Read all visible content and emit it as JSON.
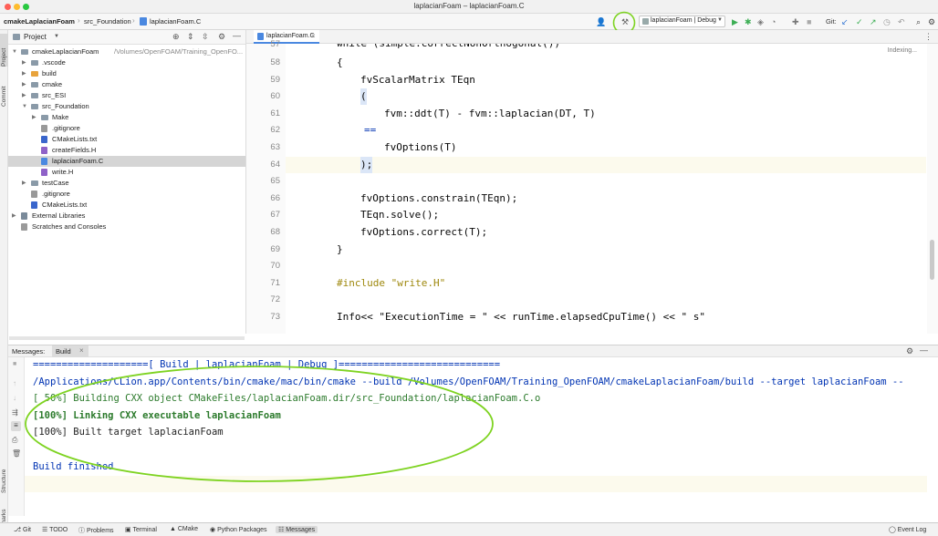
{
  "window": {
    "title": "laplacianFoam – laplacianFoam.C"
  },
  "navbar": {
    "crumbs": [
      "cmakeLaplacianFoam",
      "src_Foundation",
      "laplacianFoam.C"
    ],
    "run_config": "laplacianFoam | Debug",
    "git_label": "Git:"
  },
  "left_strip": {
    "items": [
      "Project",
      "Commit",
      "Structure",
      "Bookmarks"
    ]
  },
  "project_panel": {
    "title": "Project",
    "tree": [
      {
        "label": "cmakeLaplacianFoam",
        "path": "/Volumes/OpenFOAM/Training_OpenFO...",
        "kind": "folder",
        "indent": 0,
        "expanded": true
      },
      {
        "label": ".vscode",
        "kind": "folder",
        "indent": 1,
        "expanded": false
      },
      {
        "label": "build",
        "kind": "folder-orange",
        "indent": 1,
        "expanded": false
      },
      {
        "label": "cmake",
        "kind": "folder",
        "indent": 1,
        "expanded": false
      },
      {
        "label": "src_ESI",
        "kind": "folder",
        "indent": 1,
        "expanded": false
      },
      {
        "label": "src_Foundation",
        "kind": "folder",
        "indent": 1,
        "expanded": true
      },
      {
        "label": "Make",
        "kind": "folder",
        "indent": 2,
        "expanded": false
      },
      {
        "label": ".gitignore",
        "kind": "file-git",
        "indent": 2
      },
      {
        "label": "CMakeLists.txt",
        "kind": "file-cmake",
        "indent": 2
      },
      {
        "label": "createFields.H",
        "kind": "file-h",
        "indent": 2
      },
      {
        "label": "laplacianFoam.C",
        "kind": "file-c",
        "indent": 2,
        "selected": true
      },
      {
        "label": "write.H",
        "kind": "file-h",
        "indent": 2
      },
      {
        "label": "testCase",
        "kind": "folder",
        "indent": 1,
        "expanded": false
      },
      {
        "label": ".gitignore",
        "kind": "file-git",
        "indent": 1
      },
      {
        "label": "CMakeLists.txt",
        "kind": "file-cmake",
        "indent": 1
      },
      {
        "label": "External Libraries",
        "kind": "lib",
        "indent": 0,
        "expanded": false
      },
      {
        "label": "Scratches and Consoles",
        "kind": "scratch",
        "indent": 0
      }
    ]
  },
  "editor": {
    "tab_label": "laplacianFoam.C",
    "status": "Indexing...",
    "partial_top_line": "while (simple.correctNonOrthogonal())",
    "lines": [
      {
        "n": "58",
        "code": "{"
      },
      {
        "n": "59",
        "code": "fvScalarMatrix TEqn"
      },
      {
        "n": "60",
        "code": "("
      },
      {
        "n": "61",
        "code": "fvm::ddt(T) - fvm::laplacian(DT, T)"
      },
      {
        "n": "62",
        "code": "=="
      },
      {
        "n": "63",
        "code": "fvOptions(T)"
      },
      {
        "n": "64",
        "code": ");"
      },
      {
        "n": "65",
        "code": ""
      },
      {
        "n": "66",
        "code": "fvOptions.constrain(TEqn);"
      },
      {
        "n": "67",
        "code": "TEqn.solve();"
      },
      {
        "n": "68",
        "code": "fvOptions.correct(T);"
      },
      {
        "n": "69",
        "code": "}"
      },
      {
        "n": "70",
        "code": ""
      },
      {
        "n": "71",
        "code": "#include \"write.H\""
      },
      {
        "n": "72",
        "code": ""
      },
      {
        "n": "73",
        "code": "Info<< \"ExecutionTime = \" << runTime.elapsedCpuTime() << \" s\""
      }
    ]
  },
  "messages": {
    "label": "Messages:",
    "tab": "Build",
    "output": [
      "====================[ Build | laplacianFoam | Debug ]============================",
      "/Applications/CLion.app/Contents/bin/cmake/mac/bin/cmake --build /Volumes/OpenFOAM/Training_OpenFOAM/cmakeLaplacianFoam/build --target laplacianFoam --",
      "[ 50%] Building CXX object CMakeFiles/laplacianFoam.dir/src_Foundation/laplacianFoam.C.o",
      "[100%] Linking CXX executable laplacianFoam",
      "[100%] Built target laplacianFoam",
      "",
      "Build finished"
    ]
  },
  "statusbar": {
    "items": [
      "Git",
      "TODO",
      "Problems",
      "Terminal",
      "CMake",
      "Python Packages",
      "Messages"
    ],
    "right": "Event Log"
  },
  "colors": {
    "annotation_circle": "#7ed321",
    "accent": "#4a88e0",
    "run_green": "#3cae54"
  }
}
